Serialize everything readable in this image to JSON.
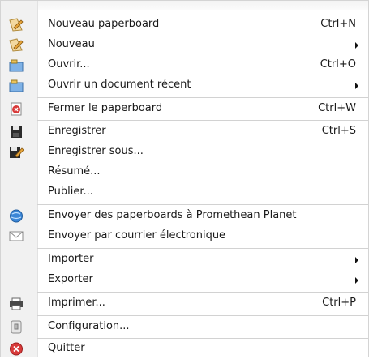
{
  "menu": {
    "items": [
      {
        "label": "Nouveau paperboard",
        "shortcut": "Ctrl+N",
        "icon": "pencil-paper-icon"
      },
      {
        "label": "Nouveau",
        "shortcut": "",
        "icon": "pencil-paper-icon"
      },
      {
        "label": "Ouvrir...",
        "shortcut": "Ctrl+O",
        "icon": "open-folder-icon"
      },
      {
        "label": "Ouvrir un document récent",
        "shortcut": "",
        "icon": "open-folder-icon"
      },
      {
        "label": "Fermer le paperboard",
        "shortcut": "Ctrl+W",
        "icon": "close-document-icon"
      },
      {
        "label": "Enregistrer",
        "shortcut": "Ctrl+S",
        "icon": "save-disk-icon"
      },
      {
        "label": "Enregistrer sous...",
        "shortcut": "",
        "icon": "save-as-icon"
      },
      {
        "label": "Résumé...",
        "shortcut": "",
        "icon": ""
      },
      {
        "label": "Publier...",
        "shortcut": "",
        "icon": ""
      },
      {
        "label": "Envoyer des paperboards à Promethean Planet",
        "shortcut": "",
        "icon": "globe-icon"
      },
      {
        "label": "Envoyer par courrier électronique",
        "shortcut": "",
        "icon": "envelope-icon"
      },
      {
        "label": "Importer",
        "shortcut": "",
        "icon": ""
      },
      {
        "label": "Exporter",
        "shortcut": "",
        "icon": ""
      },
      {
        "label": "Imprimer...",
        "shortcut": "Ctrl+P",
        "icon": "printer-icon"
      },
      {
        "label": "Configuration...",
        "shortcut": "",
        "icon": "settings-icon"
      },
      {
        "label": "Quitter",
        "shortcut": "",
        "icon": "exit-icon"
      }
    ]
  }
}
